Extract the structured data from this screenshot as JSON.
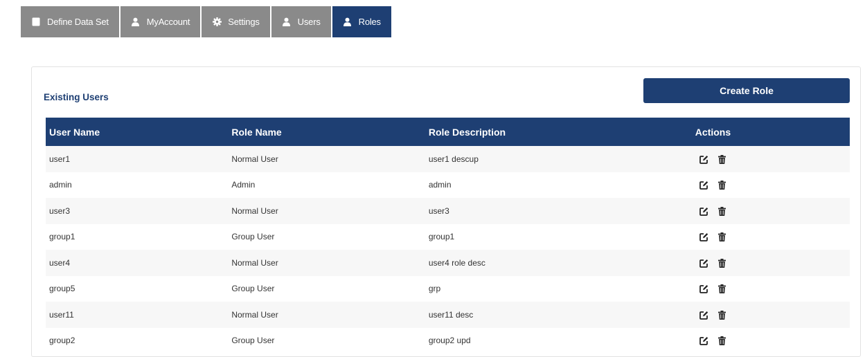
{
  "tabs": [
    {
      "label": "Define Data Set",
      "icon": "document-icon",
      "active": false
    },
    {
      "label": "MyAccount",
      "icon": "user-icon",
      "active": false
    },
    {
      "label": "Settings",
      "icon": "gear-icon",
      "active": false
    },
    {
      "label": "Users",
      "icon": "user-icon",
      "active": false
    },
    {
      "label": "Roles",
      "icon": "user-icon",
      "active": true
    }
  ],
  "panel": {
    "title": "Existing Users",
    "create_label": "Create Role"
  },
  "table": {
    "headers": {
      "user": "User Name",
      "role": "Role Name",
      "desc": "Role Description",
      "actions": "Actions"
    },
    "rows": [
      {
        "user": "user1",
        "role": "Normal User",
        "desc": "user1 descup"
      },
      {
        "user": "admin",
        "role": "Admin",
        "desc": "admin"
      },
      {
        "user": "user3",
        "role": "Normal User",
        "desc": "user3"
      },
      {
        "user": "group1",
        "role": "Group User",
        "desc": "group1"
      },
      {
        "user": "user4",
        "role": "Normal User",
        "desc": "user4 role desc"
      },
      {
        "user": "group5",
        "role": "Group User",
        "desc": "grp"
      },
      {
        "user": "user11",
        "role": "Normal User",
        "desc": "user11 desc"
      },
      {
        "user": "group2",
        "role": "Group User",
        "desc": "group2 upd"
      }
    ],
    "row_actions": [
      "edit-icon",
      "trash-icon"
    ]
  },
  "colors": {
    "primary": "#1e3f73",
    "tab_inactive": "#8a8a8a",
    "row_stripe": "#f7f7f7"
  }
}
